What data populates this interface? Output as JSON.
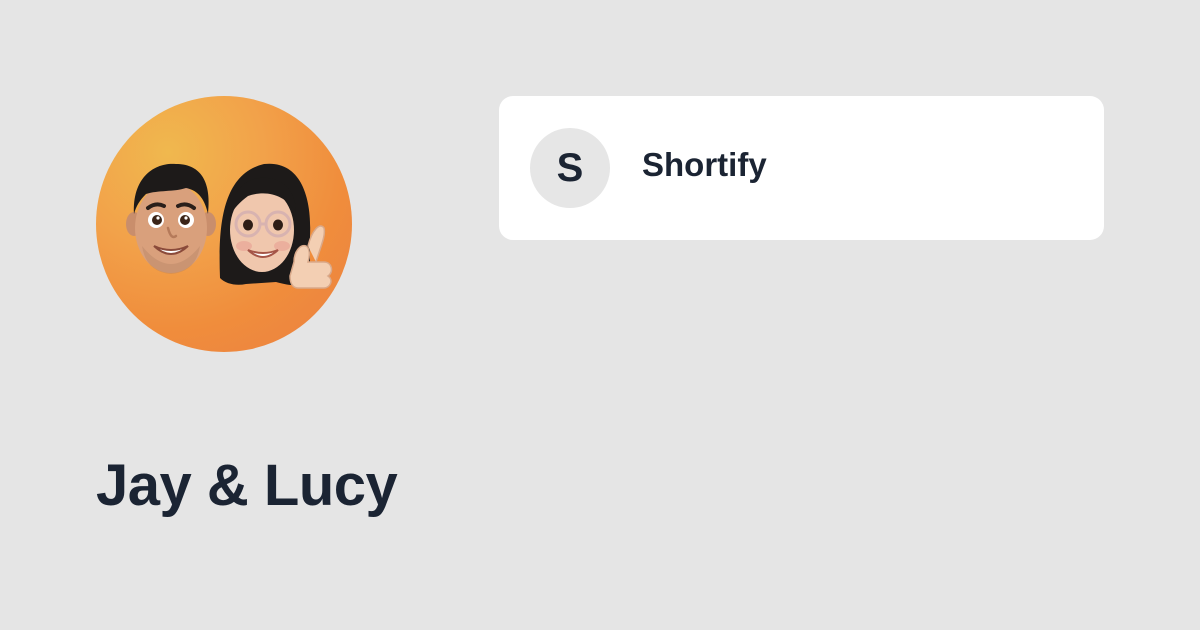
{
  "profile": {
    "name": "Jay & Lucy",
    "avatar_icon": "memoji-couple-avatar"
  },
  "links": [
    {
      "icon_letter": "S",
      "label": "Shortify"
    }
  ],
  "colors": {
    "background": "#e5e5e5",
    "card": "#ffffff",
    "text": "#1b2433",
    "icon_circle": "#e6e6e6",
    "avatar_gradient": [
      "#f0b84e",
      "#f08d3c",
      "#ea7f42"
    ]
  }
}
